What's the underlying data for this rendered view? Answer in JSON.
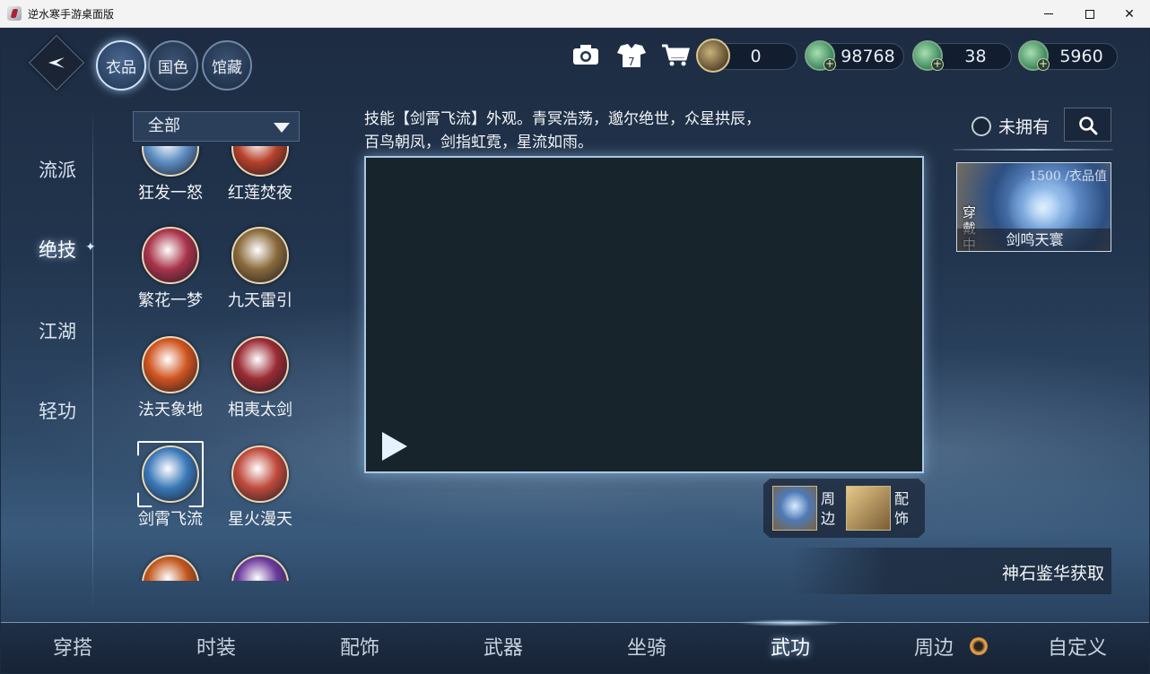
{
  "window": {
    "title": "逆水寒手游桌面版"
  },
  "top_tabs": [
    {
      "label": "衣品",
      "active": true
    },
    {
      "label": "国色",
      "active": false
    },
    {
      "label": "馆藏",
      "active": false
    }
  ],
  "toolbar": {
    "camera_icon": "camera-icon",
    "outfit_icon": "clothing-icon",
    "cart_icon": "cart-icon"
  },
  "currencies": [
    {
      "icon": "ring-coin-icon",
      "value": "0"
    },
    {
      "icon": "jade-coin-icon",
      "value": "98768"
    },
    {
      "icon": "jade-coin-icon",
      "value": "38"
    },
    {
      "icon": "jade-coin-icon",
      "value": "5960"
    }
  ],
  "categories": [
    {
      "label": "流派",
      "active": false
    },
    {
      "label": "绝技",
      "active": true
    },
    {
      "label": "江湖",
      "active": false
    },
    {
      "label": "轻功",
      "active": false
    }
  ],
  "filter": {
    "selected": "全部"
  },
  "skills": [
    {
      "label": "狂发一怒",
      "color": "#5d8fc4"
    },
    {
      "label": "红莲焚夜",
      "color": "#b8412a"
    },
    {
      "label": "繁花一梦",
      "color": "#a8334a"
    },
    {
      "label": "九天雷引",
      "color": "#8a6a3c"
    },
    {
      "label": "法天象地",
      "color": "#d0541f"
    },
    {
      "label": "相夷太剑",
      "color": "#9b2b33"
    },
    {
      "label": "剑霄飞流",
      "color": "#3a78b8",
      "selected": true
    },
    {
      "label": "星火漫天",
      "color": "#c04a3c"
    },
    {
      "label": "",
      "color": "#c2571e"
    },
    {
      "label": "",
      "color": "#6a3a9a"
    }
  ],
  "description": "技能【剑霄飞流】外观。青冥浩荡，邈尔绝世，众星拱辰，百鸟朝凤，剑指虹霓，星流如雨。",
  "related": [
    {
      "label": "周边"
    },
    {
      "label": "配饰"
    }
  ],
  "filter_owned": {
    "label": "未拥有",
    "checked": false
  },
  "search_icon": "search-icon",
  "equipped_card": {
    "value_text": "1500 /衣品值",
    "wearing": "穿戴中",
    "name": "剑鸣天寰"
  },
  "source": {
    "text": "神石鉴华获取"
  },
  "bottom_nav": [
    {
      "label": "穿搭",
      "active": false
    },
    {
      "label": "时装",
      "active": false
    },
    {
      "label": "配饰",
      "active": false
    },
    {
      "label": "武器",
      "active": false
    },
    {
      "label": "坐骑",
      "active": false
    },
    {
      "label": "武功",
      "active": true
    },
    {
      "label": "周边",
      "active": false
    },
    {
      "label": "自定义",
      "active": false
    }
  ]
}
